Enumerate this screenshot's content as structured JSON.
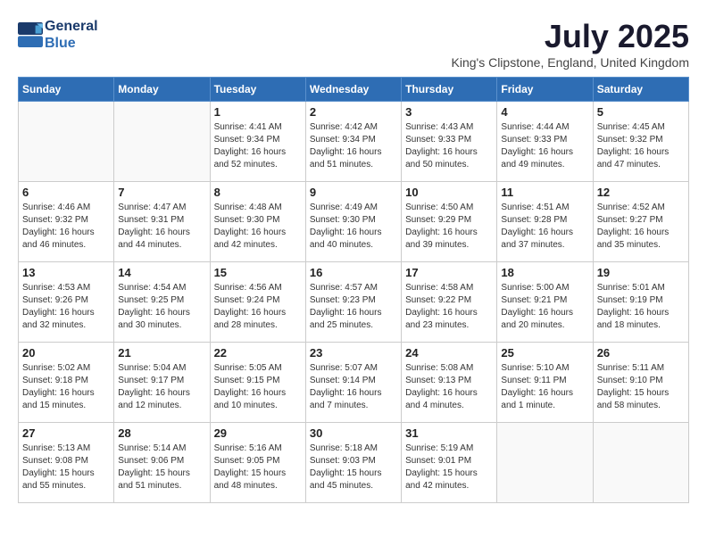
{
  "header": {
    "logo_line1": "General",
    "logo_line2": "Blue",
    "month_title": "July 2025",
    "location": "King's Clipstone, England, United Kingdom"
  },
  "days_of_week": [
    "Sunday",
    "Monday",
    "Tuesday",
    "Wednesday",
    "Thursday",
    "Friday",
    "Saturday"
  ],
  "weeks": [
    [
      {
        "day": "",
        "info": ""
      },
      {
        "day": "",
        "info": ""
      },
      {
        "day": "1",
        "info": "Sunrise: 4:41 AM\nSunset: 9:34 PM\nDaylight: 16 hours and 52 minutes."
      },
      {
        "day": "2",
        "info": "Sunrise: 4:42 AM\nSunset: 9:34 PM\nDaylight: 16 hours and 51 minutes."
      },
      {
        "day": "3",
        "info": "Sunrise: 4:43 AM\nSunset: 9:33 PM\nDaylight: 16 hours and 50 minutes."
      },
      {
        "day": "4",
        "info": "Sunrise: 4:44 AM\nSunset: 9:33 PM\nDaylight: 16 hours and 49 minutes."
      },
      {
        "day": "5",
        "info": "Sunrise: 4:45 AM\nSunset: 9:32 PM\nDaylight: 16 hours and 47 minutes."
      }
    ],
    [
      {
        "day": "6",
        "info": "Sunrise: 4:46 AM\nSunset: 9:32 PM\nDaylight: 16 hours and 46 minutes."
      },
      {
        "day": "7",
        "info": "Sunrise: 4:47 AM\nSunset: 9:31 PM\nDaylight: 16 hours and 44 minutes."
      },
      {
        "day": "8",
        "info": "Sunrise: 4:48 AM\nSunset: 9:30 PM\nDaylight: 16 hours and 42 minutes."
      },
      {
        "day": "9",
        "info": "Sunrise: 4:49 AM\nSunset: 9:30 PM\nDaylight: 16 hours and 40 minutes."
      },
      {
        "day": "10",
        "info": "Sunrise: 4:50 AM\nSunset: 9:29 PM\nDaylight: 16 hours and 39 minutes."
      },
      {
        "day": "11",
        "info": "Sunrise: 4:51 AM\nSunset: 9:28 PM\nDaylight: 16 hours and 37 minutes."
      },
      {
        "day": "12",
        "info": "Sunrise: 4:52 AM\nSunset: 9:27 PM\nDaylight: 16 hours and 35 minutes."
      }
    ],
    [
      {
        "day": "13",
        "info": "Sunrise: 4:53 AM\nSunset: 9:26 PM\nDaylight: 16 hours and 32 minutes."
      },
      {
        "day": "14",
        "info": "Sunrise: 4:54 AM\nSunset: 9:25 PM\nDaylight: 16 hours and 30 minutes."
      },
      {
        "day": "15",
        "info": "Sunrise: 4:56 AM\nSunset: 9:24 PM\nDaylight: 16 hours and 28 minutes."
      },
      {
        "day": "16",
        "info": "Sunrise: 4:57 AM\nSunset: 9:23 PM\nDaylight: 16 hours and 25 minutes."
      },
      {
        "day": "17",
        "info": "Sunrise: 4:58 AM\nSunset: 9:22 PM\nDaylight: 16 hours and 23 minutes."
      },
      {
        "day": "18",
        "info": "Sunrise: 5:00 AM\nSunset: 9:21 PM\nDaylight: 16 hours and 20 minutes."
      },
      {
        "day": "19",
        "info": "Sunrise: 5:01 AM\nSunset: 9:19 PM\nDaylight: 16 hours and 18 minutes."
      }
    ],
    [
      {
        "day": "20",
        "info": "Sunrise: 5:02 AM\nSunset: 9:18 PM\nDaylight: 16 hours and 15 minutes."
      },
      {
        "day": "21",
        "info": "Sunrise: 5:04 AM\nSunset: 9:17 PM\nDaylight: 16 hours and 12 minutes."
      },
      {
        "day": "22",
        "info": "Sunrise: 5:05 AM\nSunset: 9:15 PM\nDaylight: 16 hours and 10 minutes."
      },
      {
        "day": "23",
        "info": "Sunrise: 5:07 AM\nSunset: 9:14 PM\nDaylight: 16 hours and 7 minutes."
      },
      {
        "day": "24",
        "info": "Sunrise: 5:08 AM\nSunset: 9:13 PM\nDaylight: 16 hours and 4 minutes."
      },
      {
        "day": "25",
        "info": "Sunrise: 5:10 AM\nSunset: 9:11 PM\nDaylight: 16 hours and 1 minute."
      },
      {
        "day": "26",
        "info": "Sunrise: 5:11 AM\nSunset: 9:10 PM\nDaylight: 15 hours and 58 minutes."
      }
    ],
    [
      {
        "day": "27",
        "info": "Sunrise: 5:13 AM\nSunset: 9:08 PM\nDaylight: 15 hours and 55 minutes."
      },
      {
        "day": "28",
        "info": "Sunrise: 5:14 AM\nSunset: 9:06 PM\nDaylight: 15 hours and 51 minutes."
      },
      {
        "day": "29",
        "info": "Sunrise: 5:16 AM\nSunset: 9:05 PM\nDaylight: 15 hours and 48 minutes."
      },
      {
        "day": "30",
        "info": "Sunrise: 5:18 AM\nSunset: 9:03 PM\nDaylight: 15 hours and 45 minutes."
      },
      {
        "day": "31",
        "info": "Sunrise: 5:19 AM\nSunset: 9:01 PM\nDaylight: 15 hours and 42 minutes."
      },
      {
        "day": "",
        "info": ""
      },
      {
        "day": "",
        "info": ""
      }
    ]
  ]
}
